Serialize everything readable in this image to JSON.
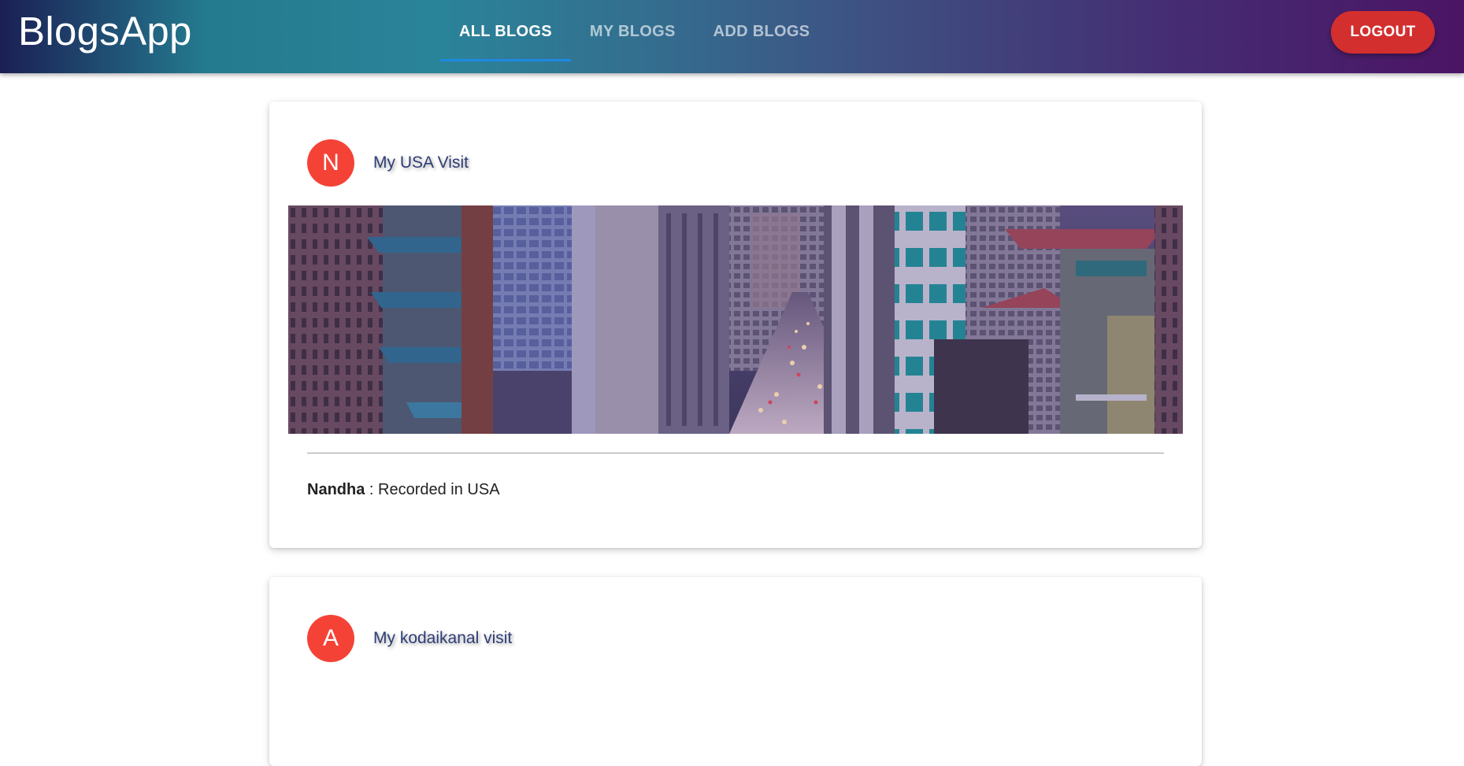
{
  "app": {
    "title": "BlogsApp"
  },
  "nav": {
    "tabs": [
      {
        "label": "ALL BLOGS",
        "active": true
      },
      {
        "label": "MY BLOGS",
        "active": false
      },
      {
        "label": "ADD BLOGS",
        "active": false
      }
    ],
    "logout_label": "LOGOUT"
  },
  "colors": {
    "accent": "#1e88e5",
    "logout": "#d32f2f",
    "avatar": "#f44336",
    "title_text": "#2f3d75"
  },
  "blogs": [
    {
      "avatar_letter": "N",
      "title": "My USA Visit",
      "author": "Nandha",
      "separator": " : ",
      "description": "Recorded in USA",
      "image_icon": "city-street-photo"
    },
    {
      "avatar_letter": "A",
      "title": "My kodaikanal visit"
    }
  ]
}
